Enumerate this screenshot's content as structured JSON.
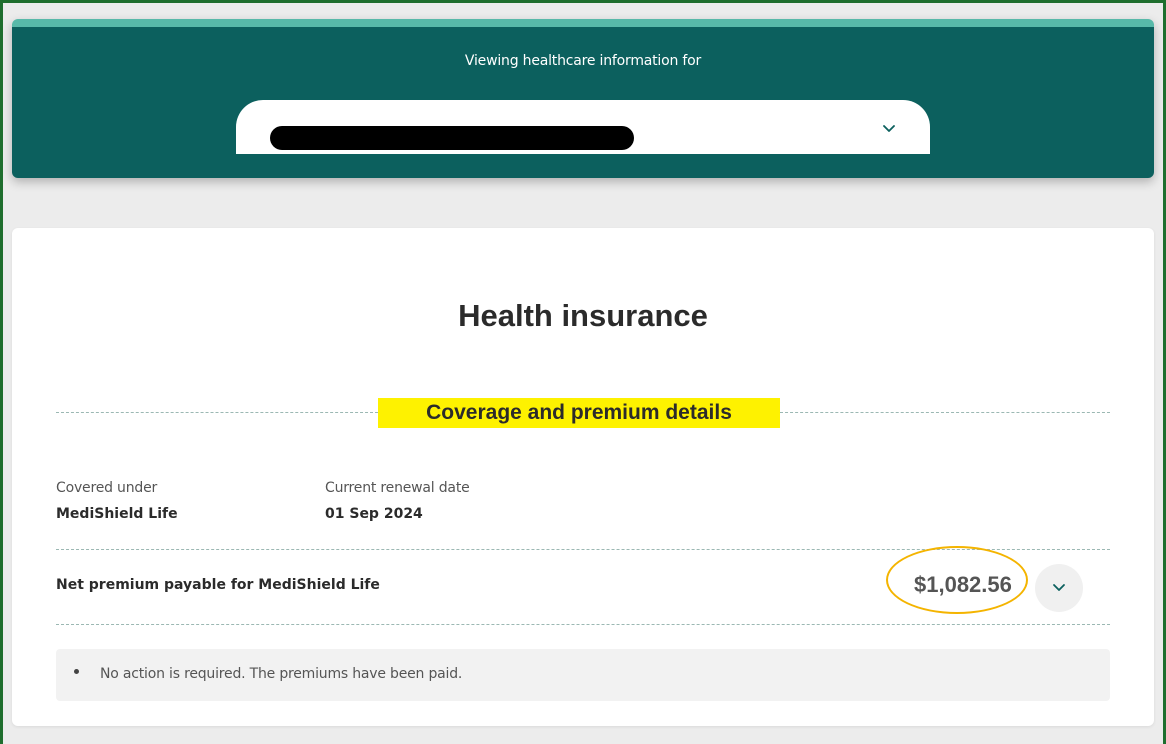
{
  "header": {
    "caption": "Viewing healthcare information for",
    "selected_person": ""
  },
  "card": {
    "title": "Health insurance",
    "section_heading": "Coverage and premium details",
    "covered_under": {
      "label": "Covered under",
      "value": "MediShield Life"
    },
    "renewal": {
      "label": "Current renewal date",
      "value": "01 Sep 2024"
    },
    "premium": {
      "label": "Net premium payable for MediShield Life",
      "amount": "$1,082.56"
    },
    "note": "No action is required. The premiums have been paid."
  },
  "colors": {
    "banner": "#0c605e",
    "banner_accent": "#58b9a9",
    "section_highlight": "#fef200",
    "annotation_ring": "#f4b400",
    "frame": "#1f6e2e"
  },
  "icons": {
    "person_select": "chevron-down-icon",
    "premium_expand": "chevron-down-icon"
  }
}
